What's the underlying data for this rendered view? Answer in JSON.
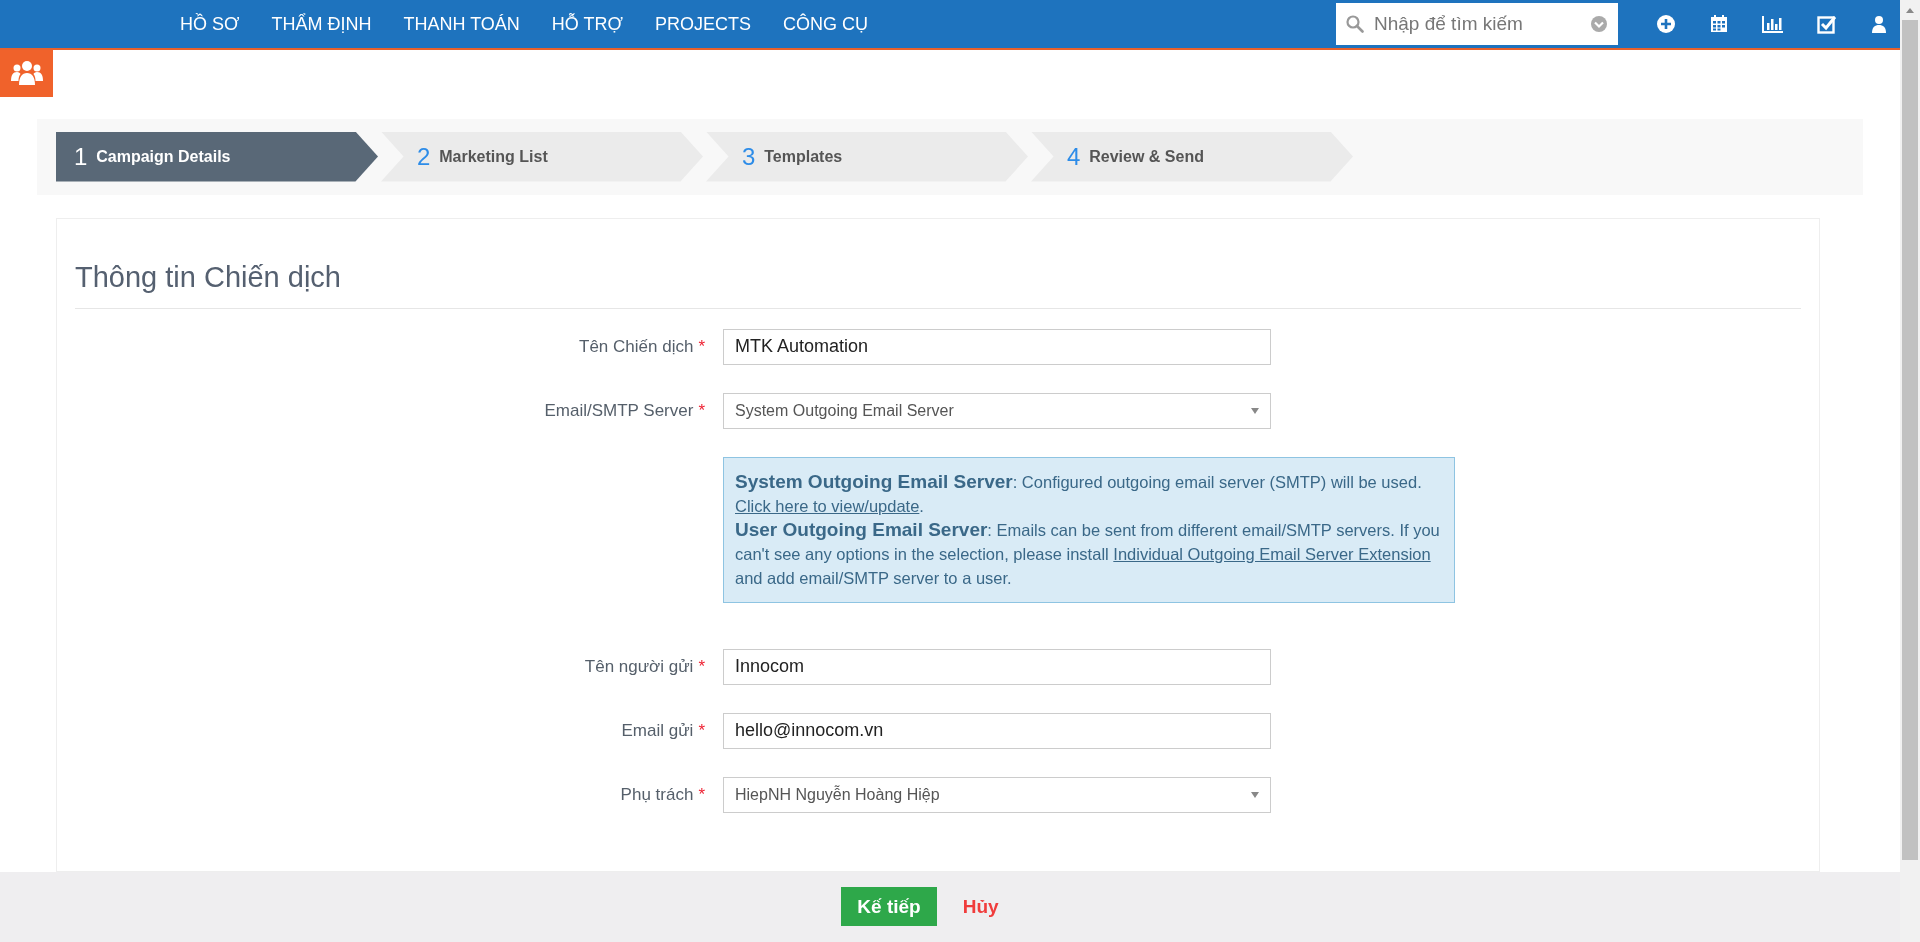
{
  "nav": {
    "items": [
      "HỒ SƠ",
      "THẨM ĐỊNH",
      "THANH TOÁN",
      "HỖ TRỢ",
      "PROJECTS",
      "CÔNG CỤ"
    ],
    "search": {
      "placeholder": "Nhập để tìm kiếm"
    }
  },
  "steps": [
    {
      "number": "1",
      "label": "Campaign Details",
      "selected": true
    },
    {
      "number": "2",
      "label": "Marketing List",
      "selected": false
    },
    {
      "number": "3",
      "label": "Templates",
      "selected": false
    },
    {
      "number": "4",
      "label": "Review & Send",
      "selected": false
    }
  ],
  "form": {
    "title": "Thông tin Chiến dịch",
    "fields": [
      {
        "label": "Tên Chiến dịch",
        "required_mark": "*",
        "kind": "text",
        "value": "MTK Automation"
      },
      {
        "label": "Email/SMTP Server",
        "required_mark": "*",
        "kind": "select",
        "value": "System Outgoing Email Server"
      }
    ],
    "info": [
      [
        {
          "kind": "strong",
          "text": "System Outgoing Email Server"
        },
        {
          "kind": "text",
          "text": ": Configured outgoing email server (SMTP) will be used."
        },
        {
          "kind": "break"
        },
        {
          "kind": "link",
          "text": "Click here to view/update"
        },
        {
          "kind": "text",
          "text": "."
        }
      ],
      [
        {
          "kind": "strong",
          "text": "User Outgoing Email Server"
        },
        {
          "kind": "text",
          "text": ": Emails can be sent from different email/SMTP servers. If you can't see any options in the selection, please install "
        },
        {
          "kind": "link",
          "text": "Individual Outgoing Email Server Extension"
        },
        {
          "kind": "text",
          "text": " and add email/SMTP server to a user."
        }
      ]
    ],
    "fields2": [
      {
        "label": "Tên người gửi",
        "required_mark": "*",
        "kind": "text",
        "value": "Innocom"
      },
      {
        "label": "Email gửi",
        "required_mark": "*",
        "kind": "text",
        "value": "hello@innocom.vn"
      },
      {
        "label": "Phụ trách",
        "required_mark": "*",
        "kind": "select",
        "value": "HiepNH Nguyễn Hoàng Hiệp"
      }
    ]
  },
  "footer": {
    "next": "Kế tiếp",
    "cancel": "Hủy"
  }
}
